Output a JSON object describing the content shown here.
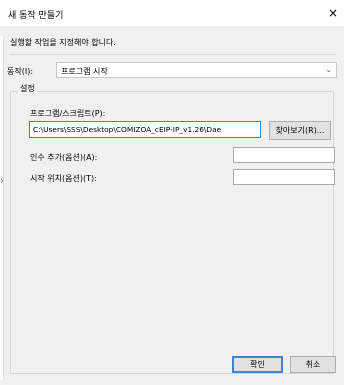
{
  "window": {
    "title": "새 동작 만들기",
    "close_glyph": "×"
  },
  "instruction": "실행할 작업을 지정해야 합니다.",
  "action": {
    "label": "동작(I):",
    "value": "프로그램 시작",
    "chevron": "⌄"
  },
  "settings": {
    "group_label": "설정",
    "program": {
      "label": "프로그램/스크립트(P):",
      "value": "C:\\Users\\SSS\\Desktop\\COMIZOA_cEIP-IP_v1.26\\Dae",
      "browse_label": "찾아보기(R)..."
    },
    "arguments": {
      "label": "인수 추가(옵션)(A):",
      "value": ""
    },
    "start_in": {
      "label": "시작 위치(옵션)(T):",
      "value": ""
    }
  },
  "buttons": {
    "ok": "확인",
    "cancel": "취소"
  },
  "colors": {
    "accent": "#3b84d9",
    "background": "#f0f0f0"
  }
}
